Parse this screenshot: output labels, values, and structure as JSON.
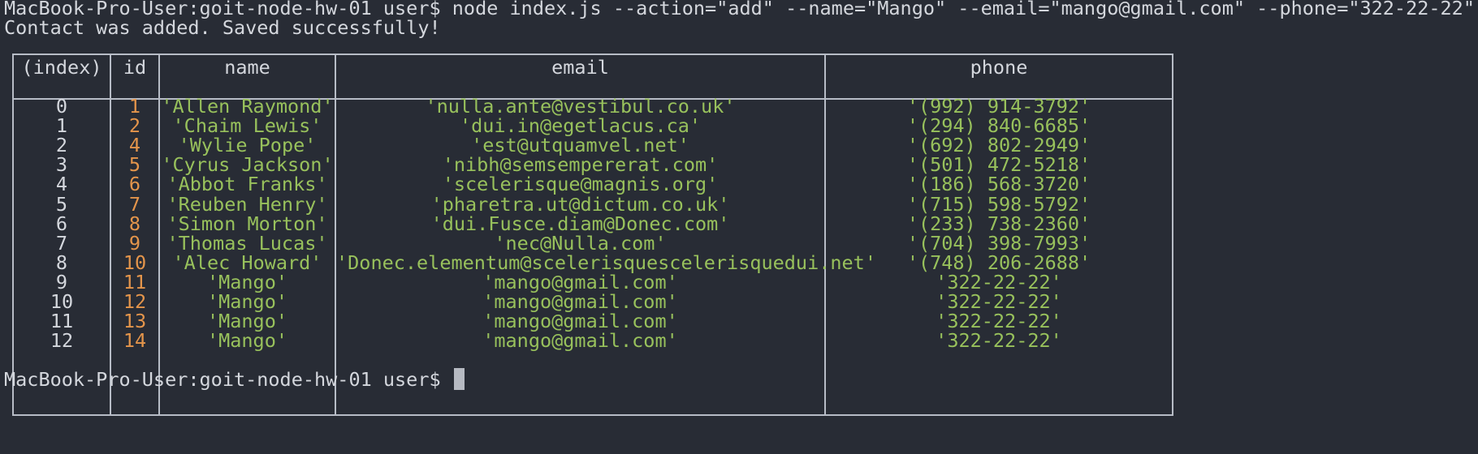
{
  "terminal": {
    "command_line": "MacBook-Pro-User:goit-node-hw-01 user$ node index.js --action=\"add\" --name=\"Mango\" --email=\"mango@gmail.com\" --phone=\"322-22-22\"",
    "output_message": "Contact was added. Saved successfully!",
    "prompt": "MacBook-Pro-User:goit-node-hw-01 user$ "
  },
  "table": {
    "headers": [
      "(index)",
      "id",
      "name",
      "email",
      "phone"
    ],
    "rows": [
      {
        "index": "0",
        "id": "1",
        "name": "'Allen Raymond'",
        "email": "'nulla.ante@vestibul.co.uk'",
        "phone": "'(992) 914-3792'"
      },
      {
        "index": "1",
        "id": "2",
        "name": "'Chaim Lewis'",
        "email": "'dui.in@egetlacus.ca'",
        "phone": "'(294) 840-6685'"
      },
      {
        "index": "2",
        "id": "4",
        "name": "'Wylie Pope'",
        "email": "'est@utquamvel.net'",
        "phone": "'(692) 802-2949'"
      },
      {
        "index": "3",
        "id": "5",
        "name": "'Cyrus Jackson'",
        "email": "'nibh@semsempererat.com'",
        "phone": "'(501) 472-5218'"
      },
      {
        "index": "4",
        "id": "6",
        "name": "'Abbot Franks'",
        "email": "'scelerisque@magnis.org'",
        "phone": "'(186) 568-3720'"
      },
      {
        "index": "5",
        "id": "7",
        "name": "'Reuben Henry'",
        "email": "'pharetra.ut@dictum.co.uk'",
        "phone": "'(715) 598-5792'"
      },
      {
        "index": "6",
        "id": "8",
        "name": "'Simon Morton'",
        "email": "'dui.Fusce.diam@Donec.com'",
        "phone": "'(233) 738-2360'"
      },
      {
        "index": "7",
        "id": "9",
        "name": "'Thomas Lucas'",
        "email": "'nec@Nulla.com'",
        "phone": "'(704) 398-7993'"
      },
      {
        "index": "8",
        "id": "10",
        "name": "'Alec Howard'",
        "email": "'Donec.elementum@scelerisquescelerisquedui.net'",
        "phone": "'(748) 206-2688'"
      },
      {
        "index": "9",
        "id": "11",
        "name": "'Mango'",
        "email": "'mango@gmail.com'",
        "phone": "'322-22-22'"
      },
      {
        "index": "10",
        "id": "12",
        "name": "'Mango'",
        "email": "'mango@gmail.com'",
        "phone": "'322-22-22'"
      },
      {
        "index": "11",
        "id": "13",
        "name": "'Mango'",
        "email": "'mango@gmail.com'",
        "phone": "'322-22-22'"
      },
      {
        "index": "12",
        "id": "14",
        "name": "'Mango'",
        "email": "'mango@gmail.com'",
        "phone": "'322-22-22'"
      }
    ]
  },
  "colors": {
    "background": "#282c35",
    "text": "#d4d7dd",
    "number": "#e4954b",
    "string": "#98c15c",
    "border": "#b7bcc6"
  }
}
